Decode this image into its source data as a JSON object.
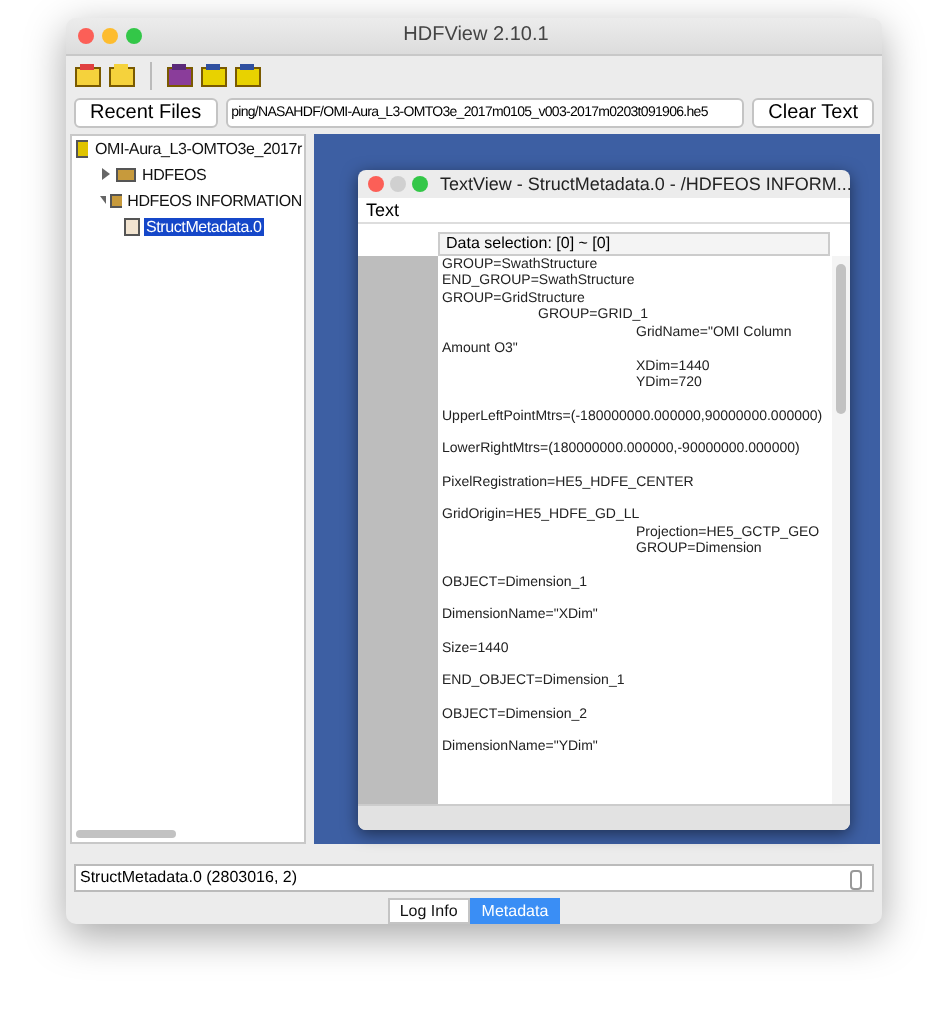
{
  "window": {
    "title": "HDFView 2.10.1"
  },
  "toolbar": {
    "recent_files": "Recent Files",
    "path": "ping/NASAHDF/OMI-Aura_L3-OMTO3e_2017m0105_v003-2017m0203t091906.he5",
    "clear_text": "Clear Text"
  },
  "tree": [
    {
      "label": "OMI-Aura_L3-OMTO3e_2017r",
      "kind": "file",
      "selected": false,
      "children": [
        {
          "label": "HDFEOS",
          "kind": "group",
          "expanded": false,
          "selected": false
        },
        {
          "label": "HDFEOS INFORMATION",
          "kind": "group",
          "expanded": true,
          "selected": false,
          "children": [
            {
              "label": "StructMetadata.0",
              "kind": "dataset",
              "selected": true
            }
          ]
        }
      ]
    }
  ],
  "text_view": {
    "title": "TextView  -  StructMetadata.0  -  /HDFEOS INFORM...",
    "menu": "Text",
    "data_selection": "Data selection:   [0] ~ [0]",
    "paragraphs": [
      [
        {
          "text": "GROUP=SwathStructure",
          "kind": "col0"
        },
        {
          "text": "END_GROUP=SwathStructure",
          "kind": "col0"
        },
        {
          "text": "GROUP=GridStructure",
          "kind": "col0"
        },
        {
          "text": "GROUP=GRID_1",
          "kind": "col1"
        },
        {
          "text": "GridName=\"OMI Column",
          "kind": "col2"
        },
        {
          "text": "Amount O3\"",
          "kind": "col0"
        },
        {
          "text": "XDim=1440",
          "kind": "col2"
        },
        {
          "text": "YDim=720",
          "kind": "col2"
        }
      ],
      [
        {
          "text": "UpperLeftPointMtrs=(-180000000.000000,90000000.000000)",
          "kind": "col0"
        }
      ],
      [
        {
          "text": "LowerRightMtrs=(180000000.000000,-90000000.000000)",
          "kind": "col0"
        }
      ],
      [
        {
          "text": "PixelRegistration=HE5_HDFE_CENTER",
          "kind": "col0"
        }
      ],
      [
        {
          "text": "GridOrigin=HE5_HDFE_GD_LL",
          "kind": "col0"
        },
        {
          "text": "Projection=HE5_GCTP_GEO",
          "kind": "col2"
        },
        {
          "text": "GROUP=Dimension",
          "kind": "col2"
        }
      ],
      [
        {
          "text": "OBJECT=Dimension_1",
          "kind": "col0"
        }
      ],
      [
        {
          "text": "DimensionName=\"XDim\"",
          "kind": "col0"
        }
      ],
      [
        {
          "text": "Size=1440",
          "kind": "col0"
        }
      ],
      [
        {
          "text": "END_OBJECT=Dimension_1",
          "kind": "col0"
        }
      ],
      [
        {
          "text": "OBJECT=Dimension_2",
          "kind": "col0"
        }
      ],
      [
        {
          "text": "DimensionName=\"YDim\"",
          "kind": "col0"
        }
      ]
    ]
  },
  "info": {
    "text": "StructMetadata.0 (2803016, 2)"
  },
  "tabs": [
    {
      "label": "Log Info",
      "selected": false
    },
    {
      "label": "Metadata",
      "selected": true
    }
  ]
}
